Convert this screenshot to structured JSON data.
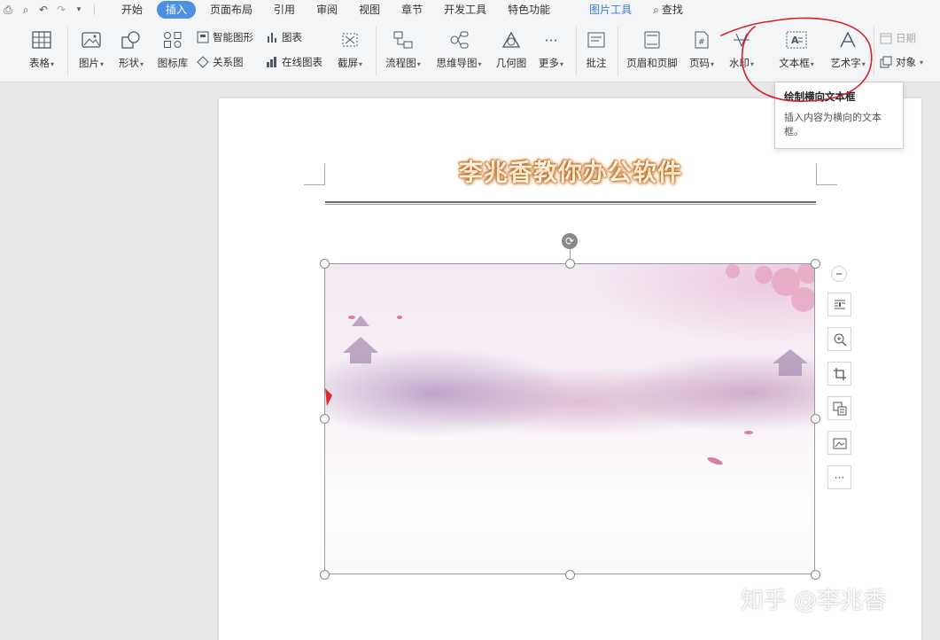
{
  "menubar": {
    "tabs": [
      "开始",
      "插入",
      "页面布局",
      "引用",
      "审阅",
      "视图",
      "章节",
      "开发工具",
      "特色功能"
    ],
    "active_tab": "插入",
    "tool_tab": "图片工具",
    "search_label": "查找"
  },
  "ribbon": {
    "table": "表格",
    "picture": "图片",
    "shape": "形状",
    "icon_lib": "图标库",
    "smart_art": "智能图形",
    "relation": "关系图",
    "chart": "图表",
    "online_chart": "在线图表",
    "screenshot": "截屏",
    "flowchart": "流程图",
    "mindmap": "思维导图",
    "geometry": "几何图",
    "more": "更多",
    "comment": "批注",
    "header_footer": "页眉和页脚",
    "page_number": "页码",
    "watermark": "水印",
    "textbox": "文本框",
    "wordart": "艺术字",
    "date": "日期",
    "object": "对象"
  },
  "tooltip": {
    "title": "绘制横向文本框",
    "desc": "插入内容为横向的文本框。"
  },
  "document": {
    "title": "李兆香教你办公软件"
  },
  "watermark_text": "知乎 @李兆香",
  "colors": {
    "accent": "#4d8fe0",
    "annotation": "#d0202a"
  }
}
